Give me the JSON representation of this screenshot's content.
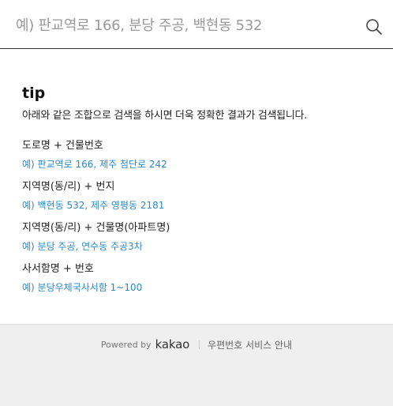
{
  "search": {
    "placeholder": "예) 판교역로 166, 분당 주공, 백현동 532",
    "value": ""
  },
  "tip": {
    "title": "tip",
    "description": "아래와 같은 조합으로 검색을 하시면 더욱 정확한 결과가 검색됩니다.",
    "items": [
      {
        "label": "도로명 + 건물번호",
        "example": "예) 판교역로 166,  제주 첨단로 242"
      },
      {
        "label": "지역명(동/리) + 번지",
        "example": "예) 백현동 532,  제주 영평동 2181"
      },
      {
        "label": "지역명(동/리) + 건물명(아파트명)",
        "example": "예) 분당 주공,  연수동 주공3차"
      },
      {
        "label": "사서함명 + 번호",
        "example": "예) 분당우체국사서함 1~100"
      }
    ]
  },
  "footer": {
    "powered_by": "Powered by",
    "logo": "kakao",
    "guide_link": "우편번호 서비스 안내"
  },
  "icons": {
    "search": "search-icon"
  },
  "colors": {
    "example_text": "#2b8ac4",
    "footer_bg": "#efefef",
    "divider": "#333333"
  }
}
